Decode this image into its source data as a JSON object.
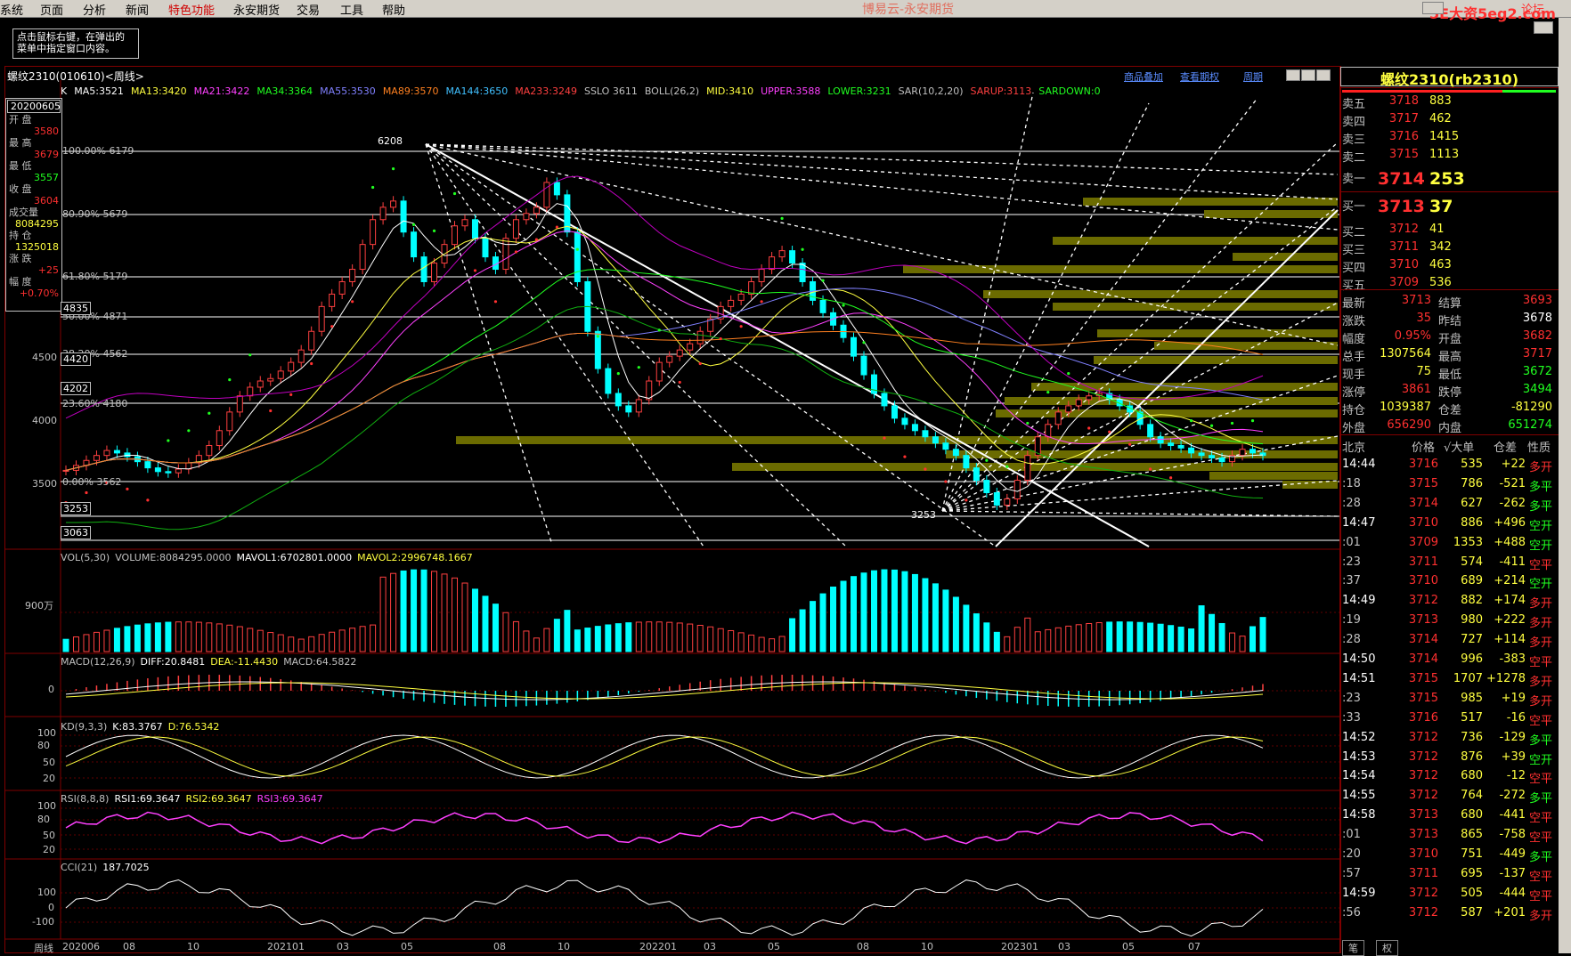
{
  "menu": [
    "系统",
    "页面",
    "分析",
    "新闻",
    "特色功能",
    "永安期货",
    "交易",
    "工具",
    "帮助"
  ],
  "app_title": "博易云-永安期货",
  "watermark": "5E大资5eg2.com",
  "watermark_tail": "论坛",
  "tip_lines": [
    "点击鼠标右键，在弹出的",
    "菜单中指定窗口内容。"
  ],
  "chart": {
    "title": "螺纹2310(010610)<周线>",
    "links": [
      "商品叠加",
      "查看期权",
      "周期"
    ],
    "ma_line": [
      {
        "text": "K",
        "color": "#ffffff"
      },
      {
        "text": "MA5:3521",
        "color": "#ffffff"
      },
      {
        "text": "MA13:3420",
        "color": "#ffff40"
      },
      {
        "text": "MA21:3422",
        "color": "#ff40ff"
      },
      {
        "text": "MA34:3364",
        "color": "#20ff20"
      },
      {
        "text": "MA55:3530",
        "color": "#8080ff"
      },
      {
        "text": "MA89:3570",
        "color": "#ff8020"
      },
      {
        "text": "MA144:3650",
        "color": "#40c0ff"
      },
      {
        "text": "MA233:3249",
        "color": "#ff4040"
      },
      {
        "text": "SSLO 3611",
        "color": "#c0c0c0"
      },
      {
        "text": "BOLL(26,2)",
        "color": "#c0c0c0"
      },
      {
        "text": "MID:3410",
        "color": "#ffff40"
      },
      {
        "text": "UPPER:3588",
        "color": "#ff40ff"
      },
      {
        "text": "LOWER:3231",
        "color": "#20ff20"
      },
      {
        "text": "SAR(10,2,20)",
        "color": "#c0c0c0"
      },
      {
        "text": "SARUP:3113",
        "color": "#ff4040"
      },
      {
        "text": "SARDOWN:0",
        "color": "#20ff20"
      }
    ],
    "info": {
      "date": "20200605",
      "open_lbl": "开 盘",
      "open": "3580",
      "high_lbl": "最 高",
      "high": "3679",
      "low_lbl": "最 低",
      "low": "3557",
      "close_lbl": "收 盘",
      "close": "3604",
      "vol_lbl": "成交量",
      "vol": "8084295",
      "oi_lbl": "持 仓",
      "oi": "1325018",
      "chg_lbl": "涨 跌",
      "chg": "+25",
      "pct_lbl": "幅 度",
      "pct": "+0.70%"
    },
    "price_axis": [
      "4500",
      "4000",
      "3500"
    ],
    "fib_labels": [
      "100.00% 6179",
      "80.90% 5679",
      "61.80% 5179",
      "50.00% 4871",
      "38.20% 4562",
      "23.60% 4180",
      "0.00% 3562"
    ],
    "boxed_prices": [
      "4835",
      "4420",
      "4202",
      "3253",
      "3063"
    ],
    "peak_label": "6208",
    "trough_label": "3253",
    "vol_label": [
      {
        "text": "VOL(5,30)",
        "color": "#c0c0c0"
      },
      {
        "text": "VOLUME:8084295.0000",
        "color": "#c0c0c0"
      },
      {
        "text": "MAVOL1:6702801.0000",
        "color": "#ffffff"
      },
      {
        "text": "MAVOL2:2996748.1667",
        "color": "#ffff40"
      }
    ],
    "vol_axis": "900万",
    "macd_label": [
      {
        "text": "MACD(12,26,9)",
        "color": "#c0c0c0"
      },
      {
        "text": "DIFF:20.8481",
        "color": "#ffffff"
      },
      {
        "text": "DEA:-11.4430",
        "color": "#ffff40"
      },
      {
        "text": "MACD:64.5822",
        "color": "#c0c0c0"
      }
    ],
    "macd_axis": "0",
    "kd_label": [
      {
        "text": "KD(9,3,3)",
        "color": "#c0c0c0"
      },
      {
        "text": "K:83.3767",
        "color": "#ffffff"
      },
      {
        "text": "D:76.5342",
        "color": "#ffff40"
      }
    ],
    "kd_axis": [
      "100",
      "80",
      "50",
      "20"
    ],
    "rsi_label": [
      {
        "text": "RSI(8,8,8)",
        "color": "#c0c0c0"
      },
      {
        "text": "RSI1:69.3647",
        "color": "#ffffff"
      },
      {
        "text": "RSI2:69.3647",
        "color": "#ffff40"
      },
      {
        "text": "RSI3:69.3647",
        "color": "#ff40ff"
      }
    ],
    "rsi_axis": [
      "100",
      "80",
      "50",
      "20"
    ],
    "cci_label": [
      {
        "text": "CCI(21)",
        "color": "#c0c0c0"
      },
      {
        "text": "187.7025",
        "color": "#ffffff"
      }
    ],
    "cci_axis": [
      "100",
      "0",
      "-100"
    ],
    "x_axis": [
      "周线",
      "202006",
      "08",
      "10",
      "202101",
      "03",
      "05",
      "08",
      "10",
      "202201",
      "03",
      "05",
      "08",
      "10",
      "202301",
      "03",
      "05",
      "07"
    ]
  },
  "quote": {
    "title": "螺纹2310(rb2310)",
    "sell": [
      {
        "lbl": "卖五",
        "p": "3718",
        "v": "883"
      },
      {
        "lbl": "卖四",
        "p": "3717",
        "v": "462"
      },
      {
        "lbl": "卖三",
        "p": "3716",
        "v": "1415"
      },
      {
        "lbl": "卖二",
        "p": "3715",
        "v": "1113"
      },
      {
        "lbl": "卖一",
        "p": "3714",
        "v": "253"
      }
    ],
    "buy": [
      {
        "lbl": "买一",
        "p": "3713",
        "v": "37"
      },
      {
        "lbl": "买二",
        "p": "3712",
        "v": "41"
      },
      {
        "lbl": "买三",
        "p": "3711",
        "v": "342"
      },
      {
        "lbl": "买四",
        "p": "3710",
        "v": "463"
      },
      {
        "lbl": "买五",
        "p": "3709",
        "v": "536"
      }
    ],
    "stats": [
      {
        "l1": "最新",
        "v1": "3713",
        "l2": "结算",
        "v2": "3693",
        "c1": "c-r",
        "c2": "c-r"
      },
      {
        "l1": "涨跌",
        "v1": "35",
        "l2": "昨结",
        "v2": "3678",
        "c1": "c-r",
        "c2": "c-w"
      },
      {
        "l1": "幅度",
        "v1": "0.95%",
        "l2": "开盘",
        "v2": "3682",
        "c1": "c-r",
        "c2": "c-r"
      },
      {
        "l1": "总手",
        "v1": "1307564",
        "l2": "最高",
        "v2": "3717",
        "c1": "c-y",
        "c2": "c-r"
      },
      {
        "l1": "现手",
        "v1": "75",
        "l2": "最低",
        "v2": "3672",
        "c1": "c-y",
        "c2": "c-g"
      },
      {
        "l1": "涨停",
        "v1": "3861",
        "l2": "跌停",
        "v2": "3494",
        "c1": "c-r",
        "c2": "c-g"
      },
      {
        "l1": "持仓",
        "v1": "1039387",
        "l2": "仓差",
        "v2": "-81290",
        "c1": "c-y",
        "c2": "c-y"
      },
      {
        "l1": "外盘",
        "v1": "656290",
        "l2": "内盘",
        "v2": "651274",
        "c1": "c-r",
        "c2": "c-g"
      }
    ],
    "tick_header": [
      "北京",
      "价格",
      "√大单",
      "仓差",
      "性质"
    ],
    "ticks": [
      {
        "t": "14:44",
        "p": "3716",
        "v": "535",
        "d": "+22",
        "n": "多开",
        "tc": "c-w",
        "nc": "c-r"
      },
      {
        "t": ":18",
        "p": "3715",
        "v": "786",
        "d": "-521",
        "n": "多平",
        "tc": "c-lbl",
        "nc": "c-g"
      },
      {
        "t": ":28",
        "p": "3714",
        "v": "627",
        "d": "-262",
        "n": "多平",
        "tc": "c-lbl",
        "nc": "c-g"
      },
      {
        "t": "14:47",
        "p": "3710",
        "v": "886",
        "d": "+496",
        "n": "空开",
        "tc": "c-w",
        "nc": "c-g"
      },
      {
        "t": ":01",
        "p": "3709",
        "v": "1353",
        "d": "+488",
        "n": "空开",
        "tc": "c-lbl",
        "nc": "c-g"
      },
      {
        "t": ":23",
        "p": "3711",
        "v": "574",
        "d": "-411",
        "n": "空平",
        "tc": "c-lbl",
        "nc": "c-r"
      },
      {
        "t": ":37",
        "p": "3710",
        "v": "689",
        "d": "+214",
        "n": "空开",
        "tc": "c-lbl",
        "nc": "c-g"
      },
      {
        "t": "14:49",
        "p": "3712",
        "v": "882",
        "d": "+174",
        "n": "多开",
        "tc": "c-w",
        "nc": "c-r"
      },
      {
        "t": ":19",
        "p": "3713",
        "v": "980",
        "d": "+222",
        "n": "多开",
        "tc": "c-lbl",
        "nc": "c-r"
      },
      {
        "t": ":28",
        "p": "3714",
        "v": "727",
        "d": "+114",
        "n": "多开",
        "tc": "c-lbl",
        "nc": "c-r"
      },
      {
        "t": "14:50",
        "p": "3714",
        "v": "996",
        "d": "-383",
        "n": "空平",
        "tc": "c-w",
        "nc": "c-r"
      },
      {
        "t": "14:51",
        "p": "3715",
        "v": "1707",
        "d": "+1278",
        "n": "多开",
        "tc": "c-w",
        "nc": "c-r"
      },
      {
        "t": ":23",
        "p": "3715",
        "v": "985",
        "d": "+19",
        "n": "多开",
        "tc": "c-lbl",
        "nc": "c-r"
      },
      {
        "t": ":33",
        "p": "3716",
        "v": "517",
        "d": "-16",
        "n": "空平",
        "tc": "c-lbl",
        "nc": "c-r"
      },
      {
        "t": "14:52",
        "p": "3712",
        "v": "736",
        "d": "-129",
        "n": "多平",
        "tc": "c-w",
        "nc": "c-g"
      },
      {
        "t": "14:53",
        "p": "3712",
        "v": "876",
        "d": "+39",
        "n": "空开",
        "tc": "c-w",
        "nc": "c-g"
      },
      {
        "t": "14:54",
        "p": "3712",
        "v": "680",
        "d": "-12",
        "n": "空平",
        "tc": "c-w",
        "nc": "c-r"
      },
      {
        "t": "14:55",
        "p": "3712",
        "v": "764",
        "d": "-272",
        "n": "多平",
        "tc": "c-w",
        "nc": "c-g"
      },
      {
        "t": "14:58",
        "p": "3713",
        "v": "680",
        "d": "-441",
        "n": "空平",
        "tc": "c-w",
        "nc": "c-r"
      },
      {
        "t": ":01",
        "p": "3713",
        "v": "865",
        "d": "-758",
        "n": "空平",
        "tc": "c-lbl",
        "nc": "c-r"
      },
      {
        "t": ":20",
        "p": "3710",
        "v": "751",
        "d": "-449",
        "n": "多平",
        "tc": "c-lbl",
        "nc": "c-g"
      },
      {
        "t": ":57",
        "p": "3711",
        "v": "695",
        "d": "-137",
        "n": "空平",
        "tc": "c-lbl",
        "nc": "c-r"
      },
      {
        "t": "14:59",
        "p": "3712",
        "v": "505",
        "d": "-444",
        "n": "空平",
        "tc": "c-w",
        "nc": "c-r"
      },
      {
        "t": ":56",
        "p": "3712",
        "v": "587",
        "d": "+201",
        "n": "多开",
        "tc": "c-lbl",
        "nc": "c-r"
      }
    ],
    "tabs": [
      "笔",
      "权"
    ]
  }
}
